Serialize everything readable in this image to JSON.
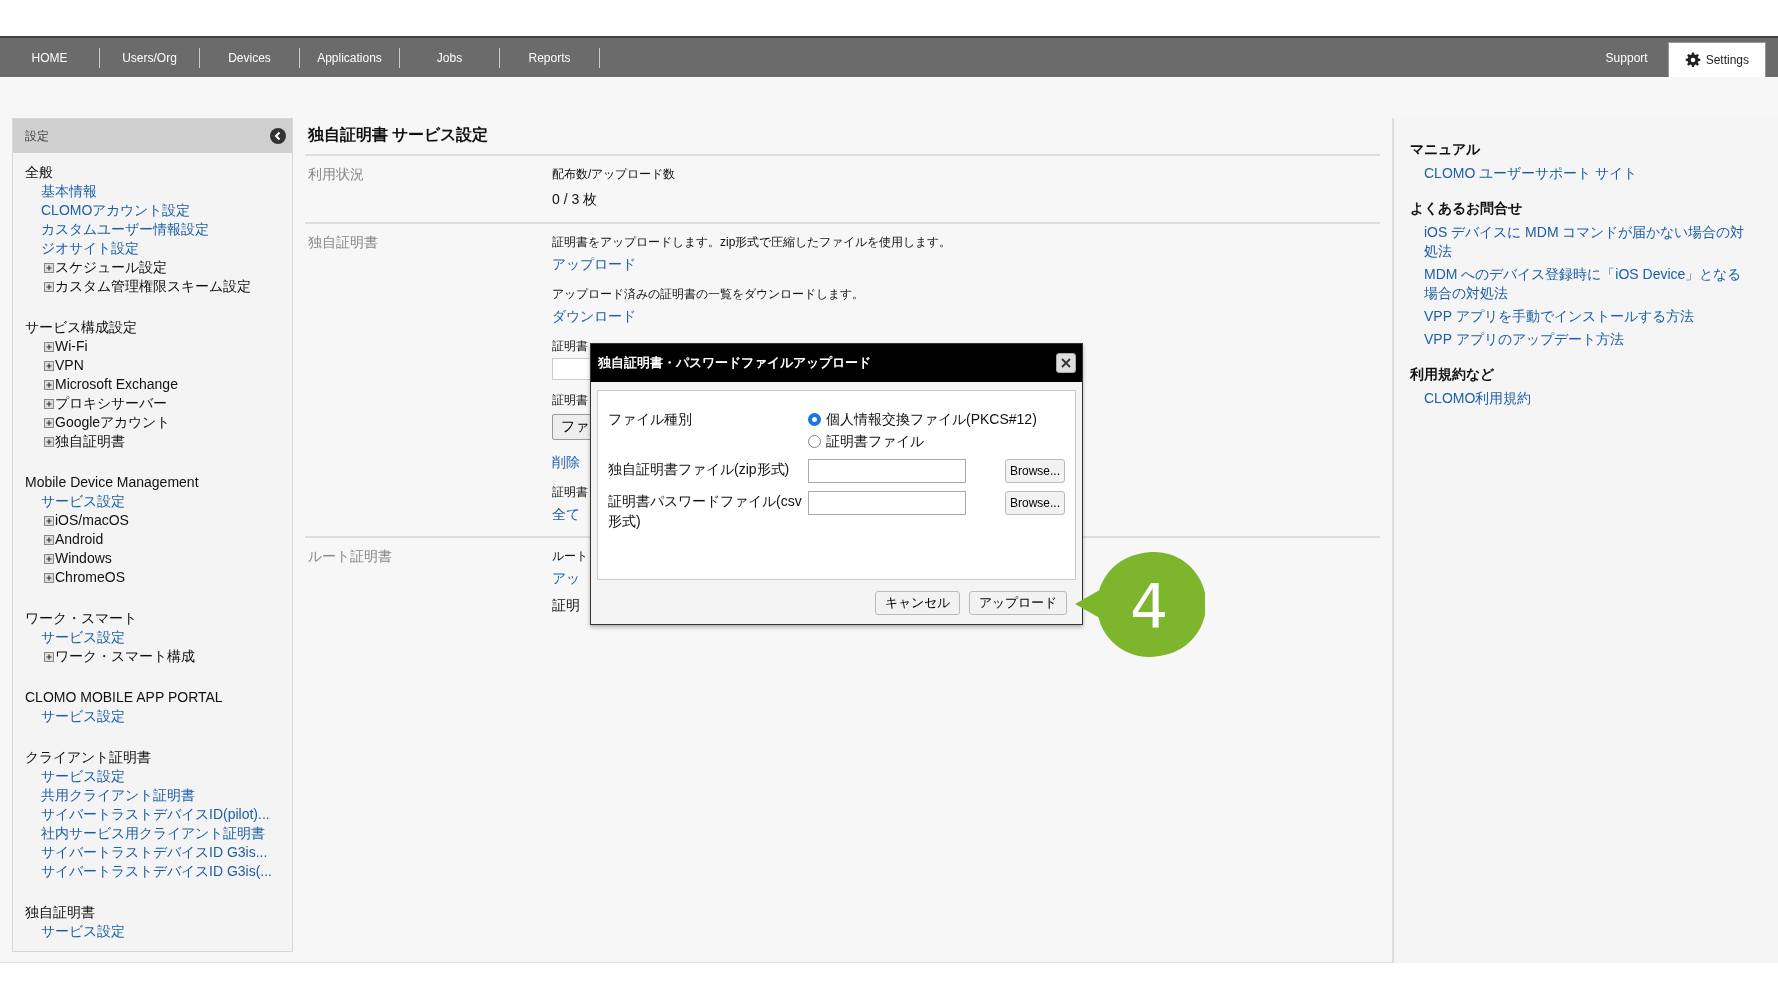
{
  "nav": {
    "left": [
      {
        "label": "HOME",
        "selected": false
      },
      {
        "label": "Users/Org",
        "selected": false
      },
      {
        "label": "Devices",
        "selected": false
      },
      {
        "label": "Applications",
        "selected": false
      },
      {
        "label": "Jobs",
        "selected": false
      },
      {
        "label": "Reports",
        "selected": false
      }
    ],
    "right": [
      {
        "label": "Support",
        "selected": false
      },
      {
        "label": "Settings",
        "selected": true,
        "kind": "gear"
      }
    ]
  },
  "sidebar": {
    "title": "設定",
    "sections": [
      {
        "heading": "全般",
        "items": [
          {
            "label": "基本情報",
            "kind": "link"
          },
          {
            "label": "CLOMOアカウント設定",
            "kind": "link"
          },
          {
            "label": "カスタムユーザー情報設定",
            "kind": "link"
          },
          {
            "label": "ジオサイト設定",
            "kind": "link"
          },
          {
            "label": "スケジュール設定",
            "kind": "tree",
            "expanded": false
          },
          {
            "label": "カスタム管理権限スキーム設定",
            "kind": "tree",
            "expanded": false
          }
        ]
      },
      {
        "heading": "サービス構成設定",
        "items": [
          {
            "label": "Wi-Fi",
            "kind": "tree",
            "expanded": false
          },
          {
            "label": "VPN",
            "kind": "tree",
            "expanded": false
          },
          {
            "label": "Microsoft Exchange",
            "kind": "tree",
            "expanded": false
          },
          {
            "label": "プロキシサーバー",
            "kind": "tree",
            "expanded": false
          },
          {
            "label": "Googleアカウント",
            "kind": "tree",
            "expanded": false
          },
          {
            "label": "独自証明書",
            "kind": "tree",
            "expanded": false
          }
        ]
      },
      {
        "heading": "Mobile Device Management",
        "items": [
          {
            "label": "サービス設定",
            "kind": "link"
          },
          {
            "label": "iOS/macOS",
            "kind": "tree",
            "expanded": false
          },
          {
            "label": "Android",
            "kind": "tree",
            "expanded": false
          },
          {
            "label": "Windows",
            "kind": "tree",
            "expanded": false
          },
          {
            "label": "ChromeOS",
            "kind": "tree",
            "expanded": false
          }
        ]
      },
      {
        "heading": "ワーク・スマート",
        "items": [
          {
            "label": "サービス設定",
            "kind": "link"
          },
          {
            "label": "ワーク・スマート構成",
            "kind": "tree",
            "expanded": false
          }
        ]
      },
      {
        "heading": "CLOMO MOBILE APP PORTAL",
        "items": [
          {
            "label": "サービス設定",
            "kind": "link"
          }
        ]
      },
      {
        "heading": "クライアント証明書",
        "items": [
          {
            "label": "サービス設定",
            "kind": "link"
          },
          {
            "label": "共用クライアント証明書",
            "kind": "link"
          },
          {
            "label": "サイバートラストデバイスID(pilot)...",
            "kind": "link"
          },
          {
            "label": "社内サービス用クライアント証明書",
            "kind": "link"
          },
          {
            "label": "サイバートラストデバイスID G3is...",
            "kind": "link"
          },
          {
            "label": "サイバートラストデバイスID G3is(...",
            "kind": "link"
          }
        ]
      },
      {
        "heading": "独自証明書",
        "items": [
          {
            "label": "サービス設定",
            "kind": "link"
          }
        ]
      }
    ]
  },
  "main": {
    "title": "独自証明書 サービス設定",
    "rows": [
      {
        "label": "利用状況",
        "blocks": [
          {
            "kind": "note",
            "text": "配布数/アップロード数"
          },
          {
            "kind": "value",
            "text": "0 / 3 枚"
          }
        ]
      },
      {
        "label": "独自証明書",
        "blocks": [
          {
            "kind": "note",
            "text": "証明書をアップロードします。zip形式で圧縮したファイルを使用します。"
          },
          {
            "kind": "link",
            "text": "アップロード"
          },
          {
            "kind": "note",
            "text": "アップロード済みの証明書の一覧をダウンロードします。"
          },
          {
            "kind": "link",
            "text": "ダウンロード"
          },
          {
            "kind": "note",
            "text": "証明書"
          },
          {
            "kind": "field"
          },
          {
            "kind": "note",
            "text": "証明書"
          },
          {
            "kind": "button",
            "text": "ファ"
          },
          {
            "kind": "link",
            "text": "削除"
          },
          {
            "kind": "note",
            "text": "証明書"
          },
          {
            "kind": "link",
            "text": "全て"
          }
        ]
      },
      {
        "label": "ルート証明書",
        "blocks": [
          {
            "kind": "note",
            "text": "ルート"
          },
          {
            "kind": "link",
            "text": "アッ"
          },
          {
            "kind": "value",
            "text": "証明"
          }
        ]
      }
    ]
  },
  "help": {
    "sections": [
      {
        "heading": "マニュアル",
        "links": [
          "CLOMO ユーザーサポート サイト"
        ]
      },
      {
        "heading": "よくあるお問合せ",
        "links": [
          "iOS デバイスに MDM コマンドが届かない場合の対処法",
          "MDM へのデバイス登録時に「iOS Device」となる場合の対処法",
          "VPP アプリを手動でインストールする方法",
          "VPP アプリのアップデート方法"
        ]
      },
      {
        "heading": "利用規約など",
        "links": [
          "CLOMO利用規約"
        ]
      }
    ]
  },
  "dialog": {
    "title": "独自証明書・パスワードファイルアップロード",
    "fields": [
      {
        "kind": "radio",
        "label": "ファイル種別",
        "options": [
          {
            "label": "個人情報交換ファイル(PKCS#12)",
            "selected": true
          },
          {
            "label": "証明書ファイル",
            "selected": false
          }
        ]
      },
      {
        "kind": "file",
        "label": "独自証明書ファイル(zip形式)",
        "button": "Browse..."
      },
      {
        "kind": "file",
        "label": "証明書パスワードファイル(csv形式)",
        "button": "Browse..."
      }
    ],
    "buttons": [
      "キャンセル",
      "アップロード"
    ]
  },
  "callout": {
    "number": "4"
  }
}
